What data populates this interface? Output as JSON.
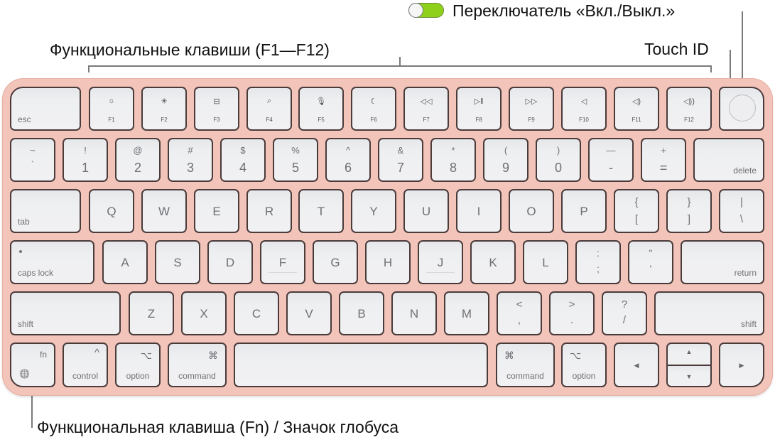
{
  "callouts": {
    "function_keys": "Функциональные клавиши (F1—F12)",
    "power_switch": "Переключатель «Вкл./Выкл.»",
    "touch_id": "Touch ID",
    "fn_globe": "Функциональная клавиша (Fn) / Значок глобуса"
  },
  "colors": {
    "keyboard_body": "#f3c4b9",
    "key_face": "#eeeff1",
    "toggle_on": "#8fd11a"
  },
  "keys": {
    "esc": "esc",
    "f": [
      {
        "label": "F1",
        "icon": "☼"
      },
      {
        "label": "F2",
        "icon": "☀"
      },
      {
        "label": "F3",
        "icon": "⊟"
      },
      {
        "label": "F4",
        "icon": "⌕"
      },
      {
        "label": "F5",
        "icon": "🎙"
      },
      {
        "label": "F6",
        "icon": "☾"
      },
      {
        "label": "F7",
        "icon": "◁◁"
      },
      {
        "label": "F8",
        "icon": "▷ǁ"
      },
      {
        "label": "F9",
        "icon": "▷▷"
      },
      {
        "label": "F10",
        "icon": "◁"
      },
      {
        "label": "F11",
        "icon": "◁)"
      },
      {
        "label": "F12",
        "icon": "◁))"
      }
    ],
    "num_row": [
      {
        "top": "~",
        "bot": "`"
      },
      {
        "top": "!",
        "bot": "1"
      },
      {
        "top": "@",
        "bot": "2"
      },
      {
        "top": "#",
        "bot": "3"
      },
      {
        "top": "$",
        "bot": "4"
      },
      {
        "top": "%",
        "bot": "5"
      },
      {
        "top": "^",
        "bot": "6"
      },
      {
        "top": "&",
        "bot": "7"
      },
      {
        "top": "*",
        "bot": "8"
      },
      {
        "top": "(",
        "bot": "9"
      },
      {
        "top": ")",
        "bot": "0"
      },
      {
        "top": "—",
        "bot": "-"
      },
      {
        "top": "+",
        "bot": "="
      }
    ],
    "delete": "delete",
    "tab": "tab",
    "qrow": [
      "Q",
      "W",
      "E",
      "R",
      "T",
      "Y",
      "U",
      "I",
      "O",
      "P"
    ],
    "bracket_open": {
      "top": "{",
      "bot": "["
    },
    "bracket_close": {
      "top": "}",
      "bot": "]"
    },
    "backslash": {
      "top": "|",
      "bot": "\\"
    },
    "caps_lock": "caps lock",
    "arow": [
      "A",
      "S",
      "D",
      "F",
      "G",
      "H",
      "J",
      "K",
      "L"
    ],
    "semicolon": {
      "top": ":",
      "bot": ";"
    },
    "quote": {
      "top": "\"",
      "bot": "'"
    },
    "return": "return",
    "shift": "shift",
    "zrow": [
      "Z",
      "X",
      "C",
      "V",
      "B",
      "N",
      "M"
    ],
    "comma": {
      "top": "<",
      "bot": ","
    },
    "period": {
      "top": ">",
      "bot": "."
    },
    "slash": {
      "top": "?",
      "bot": "/"
    },
    "fn": "fn",
    "globe_icon": "🌐",
    "control": "control",
    "control_symbol": "^",
    "option": "option",
    "option_symbol": "⌥",
    "command": "command",
    "command_symbol": "⌘",
    "arrow_left": "◀",
    "arrow_up": "▲",
    "arrow_down": "▼",
    "arrow_right": "▶"
  }
}
